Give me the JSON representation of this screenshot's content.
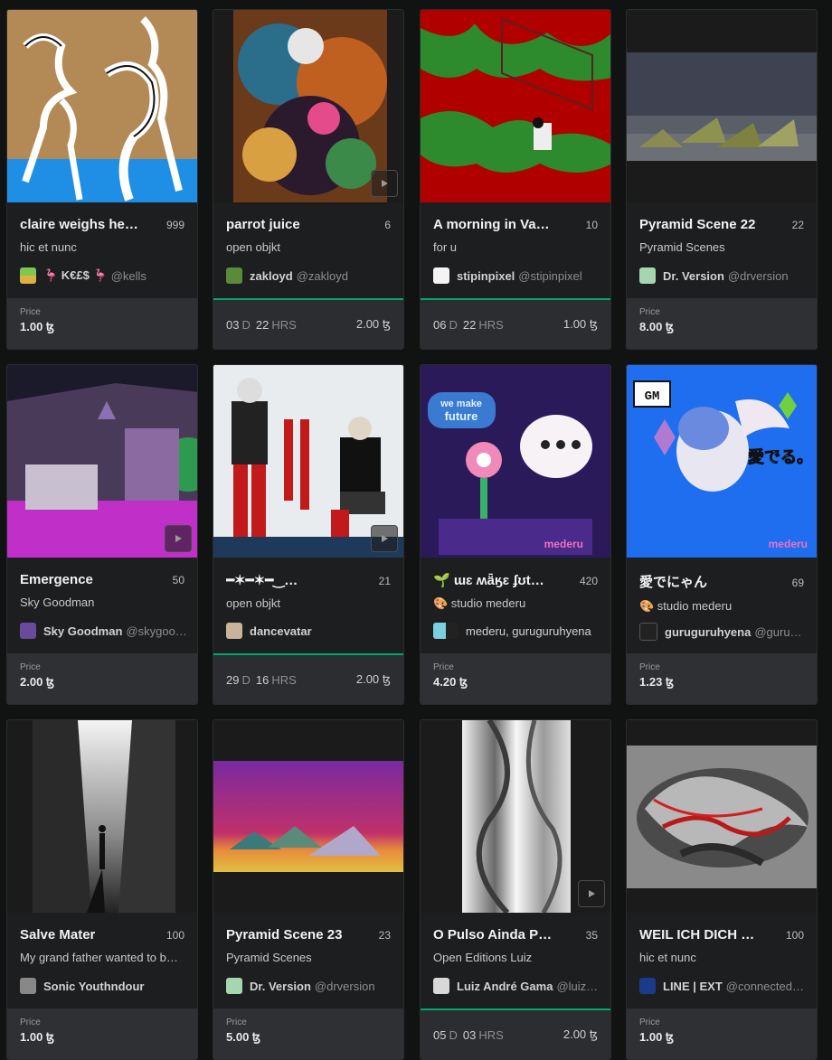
{
  "cards": [
    {
      "title": "claire weighs he…",
      "count": "999",
      "subtitle": "hic et nunc",
      "creator": "🦩 K€£$ 🦩",
      "handle": "@kells",
      "type": "price",
      "price_label": "Price",
      "price": "1.00 ꜩ"
    },
    {
      "title": "parrot juice",
      "count": "6",
      "subtitle": "open objkt",
      "creator": "zakloyd",
      "handle": "@zakloyd",
      "type": "auction",
      "days": "03",
      "day_unit": "D",
      "hours": "22",
      "hour_unit": "HRS",
      "bid": "2.00 ꜩ"
    },
    {
      "title": "A morning in Va…",
      "count": "10",
      "subtitle": "for u",
      "creator": "stipinpixel",
      "handle": "@stipinpixel",
      "type": "auction",
      "days": "06",
      "day_unit": "D",
      "hours": "22",
      "hour_unit": "HRS",
      "bid": "1.00 ꜩ"
    },
    {
      "title": "Pyramid Scene 22",
      "count": "22",
      "subtitle": "Pyramid Scenes",
      "creator": "Dr. Version",
      "handle": "@drversion",
      "type": "price",
      "price_label": "Price",
      "price": "8.00 ꜩ"
    },
    {
      "title": "Emergence",
      "count": "50",
      "subtitle": "Sky Goodman",
      "creator": "Sky Goodman",
      "handle": "@skygoo…",
      "type": "price",
      "price_label": "Price",
      "price": "2.00 ꜩ"
    },
    {
      "title": "━✶━✶━‿…",
      "count": "21",
      "subtitle": "open objkt",
      "creator": "dancevatar",
      "handle": "",
      "type": "auction",
      "days": "29",
      "day_unit": "D",
      "hours": "16",
      "hour_unit": "HRS",
      "bid": "2.00 ꜩ"
    },
    {
      "title": "🌱 ɯɛ ʍǟӄɛ ʄʊt…",
      "count": "420",
      "subtitle": "🎨 studio mederu",
      "creator": "mederu, guruguruhyena",
      "handle": "",
      "type": "price",
      "price_label": "Price",
      "price": "4.20 ꜩ"
    },
    {
      "title": "愛でにゃん",
      "count": "69",
      "subtitle": "🎨 studio mederu",
      "creator": "guruguruhyena",
      "handle": "@guru…",
      "type": "price",
      "price_label": "Price",
      "price": "1.23 ꜩ"
    },
    {
      "title": "Salve Mater",
      "count": "100",
      "subtitle": "My grand father wanted to be…",
      "creator": "Sonic Youthndour",
      "handle": "",
      "type": "price",
      "price_label": "Price",
      "price": "1.00 ꜩ"
    },
    {
      "title": "Pyramid Scene 23",
      "count": "23",
      "subtitle": "Pyramid Scenes",
      "creator": "Dr. Version",
      "handle": "@drversion",
      "type": "price",
      "price_label": "Price",
      "price": "5.00 ꜩ"
    },
    {
      "title": "O Pulso Ainda P…",
      "count": "35",
      "subtitle": "Open Editions Luiz",
      "creator": "Luiz André Gama",
      "handle": "@luiz…",
      "type": "auction",
      "days": "05",
      "day_unit": "D",
      "hours": "03",
      "hour_unit": "HRS",
      "bid": "2.00 ꜩ"
    },
    {
      "title": "WEIL ICH DICH …",
      "count": "100",
      "subtitle": "hic et nunc",
      "creator": "LINE | EXT",
      "handle": "@connected…",
      "type": "price",
      "price_label": "Price",
      "price": "1.00 ꜩ"
    }
  ],
  "artwork_text": {
    "mederu_tag": "mederu",
    "we_make": "we make",
    "future": "future",
    "gm": "GM",
    "medeteru": "愛でる。"
  },
  "colors": {
    "auction_border": "#00a86b",
    "card_bg": "#1d1e1f",
    "footer_bg": "#2e3033"
  }
}
